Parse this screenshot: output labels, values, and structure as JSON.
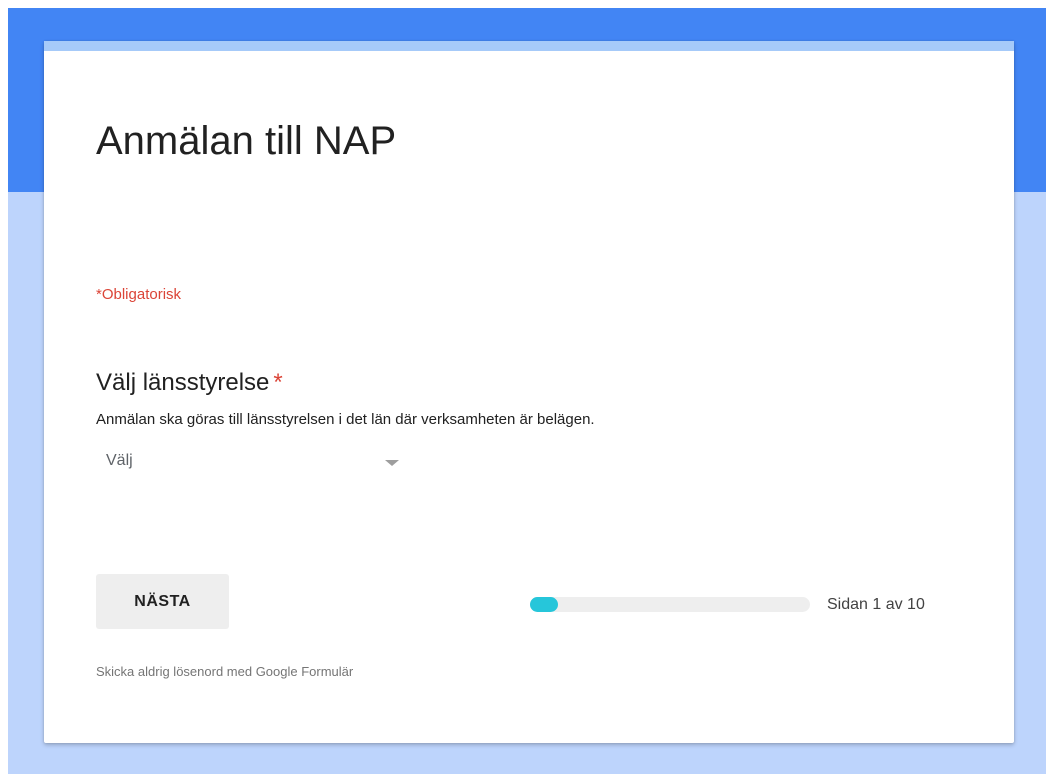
{
  "form": {
    "title": "Anmälan till NAP",
    "required_note": "*Obligatorisk"
  },
  "question": {
    "title": "Välj länsstyrelse",
    "required_marker": "*",
    "description": "Anmälan ska göras till länsstyrelsen i det län där verksamheten är belägen.",
    "dropdown": {
      "selected": "Välj"
    }
  },
  "navigation": {
    "next_label": "NÄSTA",
    "current_page": 1,
    "total_pages": 10,
    "progress_fraction": 0.1,
    "page_text": "Sidan 1 av 10"
  },
  "footer": {
    "note": "Skicka aldrig lösenord med Google Formulär"
  },
  "colors": {
    "header_blue": "#4285f4",
    "background_light_blue": "#bdd4fc",
    "card_accent": "#a6caf9",
    "required_red": "#db4437",
    "progress_cyan": "#26c6da"
  },
  "icons": {
    "dropdown": "dropdown-arrow-icon"
  }
}
